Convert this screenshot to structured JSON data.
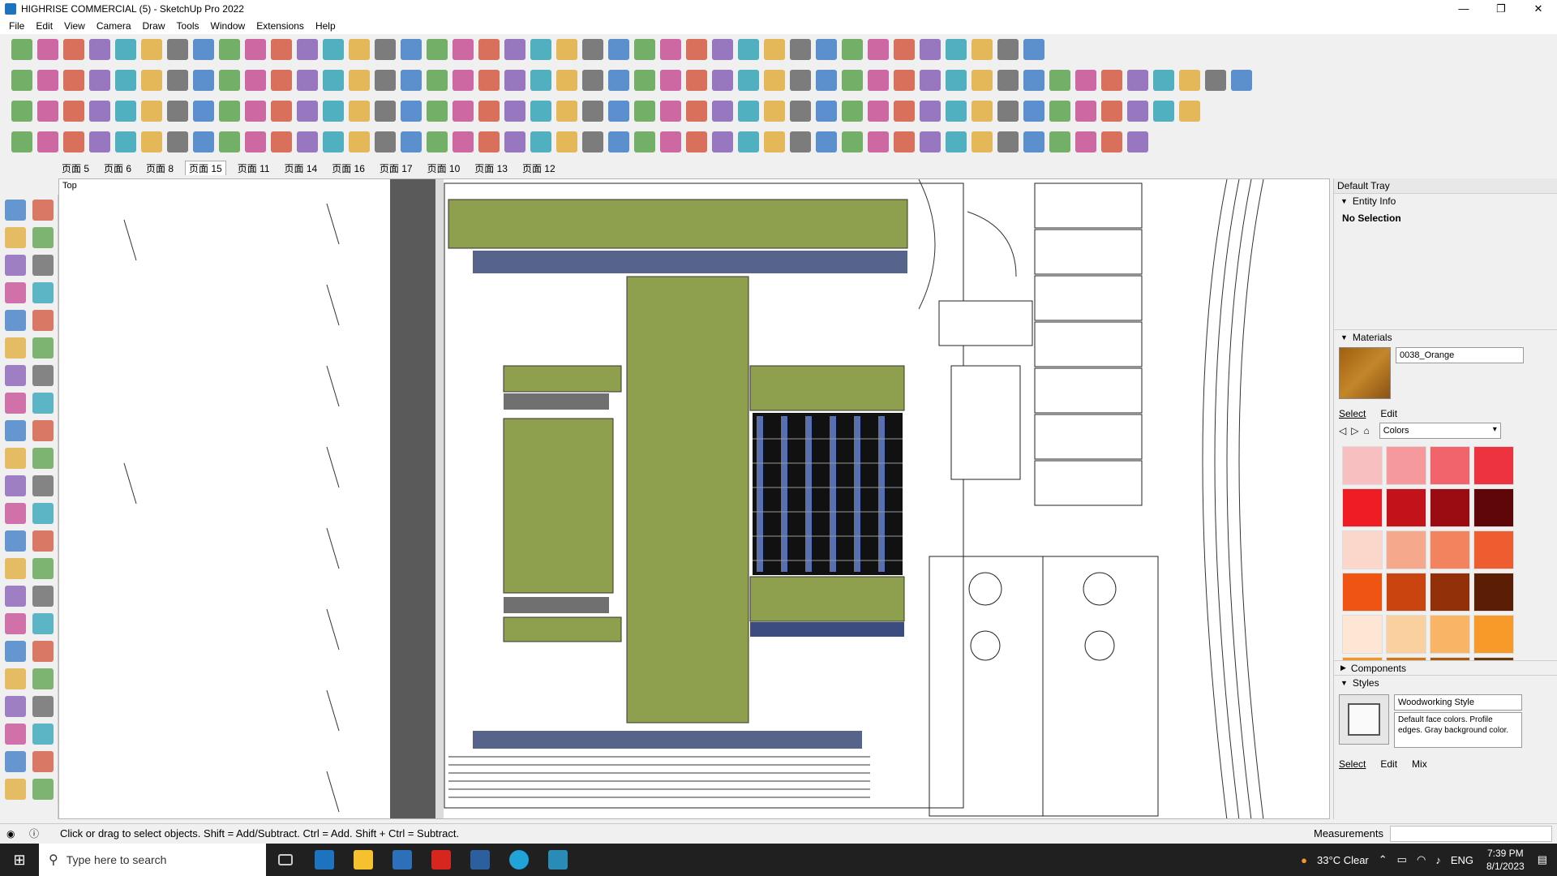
{
  "window": {
    "title": "HIGHRISE COMMERCIAL (5) - SketchUp Pro 2022",
    "minimize": "—",
    "maximize": "❐",
    "close": "✕"
  },
  "menu": [
    "File",
    "Edit",
    "View",
    "Camera",
    "Draw",
    "Tools",
    "Window",
    "Extensions",
    "Help"
  ],
  "scenes": {
    "items": [
      "页面 5",
      "页面 6",
      "页面 8",
      "页面 15",
      "页面 11",
      "页面 14",
      "页面 16",
      "页面 17",
      "页面 10",
      "页面 13",
      "页面 12"
    ],
    "active": "页面 15"
  },
  "viewport": {
    "view_name": "Top"
  },
  "tray": {
    "title": "Default Tray",
    "entity_info": {
      "heading": "Entity Info",
      "status": "No Selection"
    },
    "materials": {
      "heading": "Materials",
      "name": "0038_Orange",
      "tabs": [
        "Select",
        "Edit"
      ],
      "library": "Colors",
      "colors": [
        "#f7bfc0",
        "#f5999c",
        "#f2646b",
        "#ee3340",
        "#ef1c24",
        "#c4121a",
        "#9b0c12",
        "#5f0608",
        "#fbd7cb",
        "#f5a88c",
        "#f1835e",
        "#ee5d2f",
        "#f05413",
        "#c9440e",
        "#923009",
        "#5b1d04",
        "#fde7d4",
        "#fbd09f",
        "#f9b466",
        "#f79a2a",
        "#f7941d",
        "#d27616",
        "#a95a10",
        "#6b390a"
      ]
    },
    "components": {
      "heading": "Components"
    },
    "styles": {
      "heading": "Styles",
      "name": "Woodworking Style",
      "description": "Default face colors. Profile edges. Gray background color.",
      "tabs": [
        "Select",
        "Edit",
        "Mix"
      ]
    }
  },
  "status": {
    "hint": "Click or drag to select objects. Shift = Add/Subtract. Ctrl = Add. Shift + Ctrl = Subtract.",
    "measurements_label": "Measurements"
  },
  "taskbar": {
    "search_placeholder": "Type here to search",
    "weather": "33°C  Clear",
    "language": "ENG",
    "time": "7:39 PM",
    "date": "8/1/2023"
  }
}
